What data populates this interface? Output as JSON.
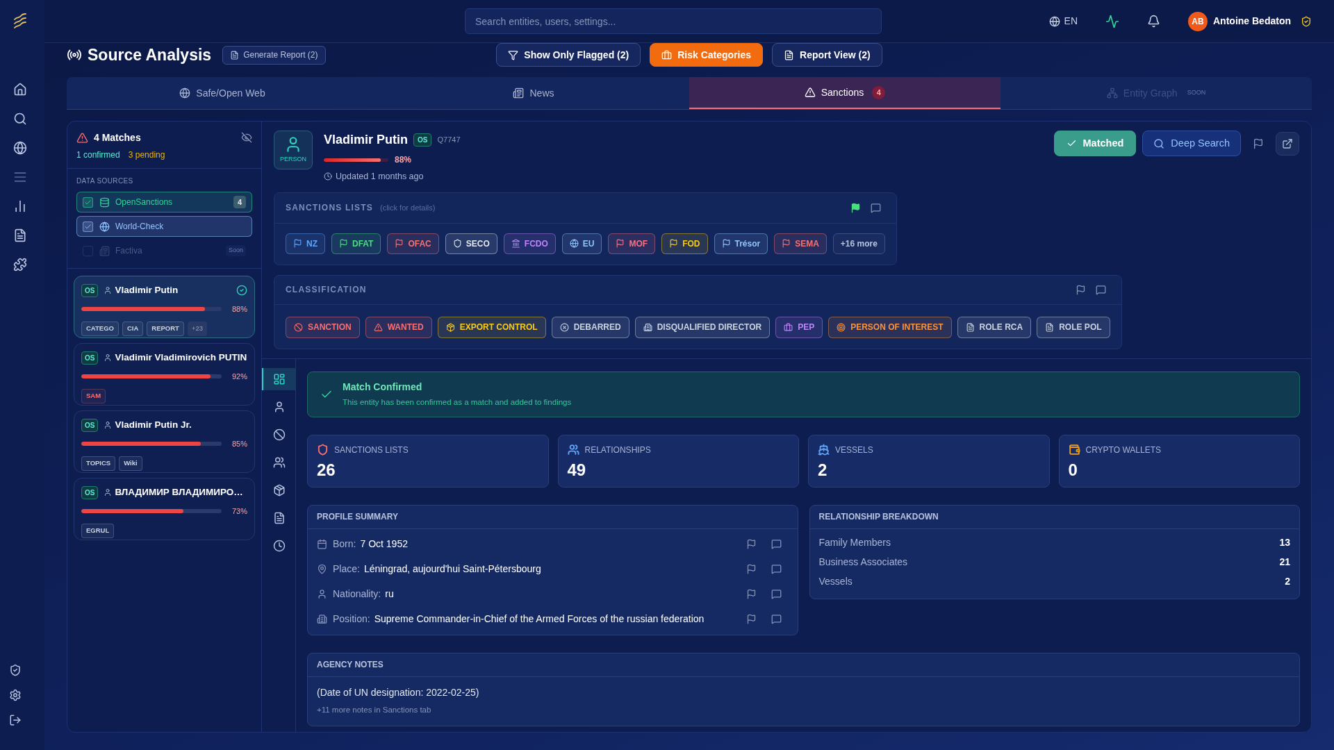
{
  "top_bar": {
    "search": {
      "placeholder": "Search entities, users, settings..."
    },
    "language": "EN",
    "user": {
      "initials": "AB",
      "name": "Antoine Bedaton"
    }
  },
  "sidebar": {
    "items": [
      {
        "disabled": false
      },
      {
        "disabled": false
      },
      {
        "disabled": false
      },
      {
        "disabled": true
      },
      {
        "disabled": false
      },
      {
        "disabled": false
      },
      {
        "disabled": false
      }
    ]
  },
  "page": {
    "title": "Source Analysis",
    "generate_report": "Generate Report (2)",
    "actions": [
      {
        "label": "Show Only Flagged (2)",
        "selected": false
      },
      {
        "label": "Risk Categories",
        "selected": true
      },
      {
        "label": "Report View (2)",
        "selected": false
      }
    ]
  },
  "tabs": [
    {
      "label": "Safe/Open Web",
      "selected": false,
      "disabled": false
    },
    {
      "label": "News",
      "selected": false,
      "disabled": false
    },
    {
      "label": "Sanctions",
      "selected": true,
      "disabled": false,
      "count": "4"
    },
    {
      "label": "Entity Graph",
      "selected": false,
      "disabled": true,
      "note": "SOON"
    }
  ],
  "matches_panel": {
    "title": "4 Matches",
    "confirmed": "1 confirmed",
    "pending": "3 pending",
    "data_sources": {
      "label": "DATA SOURCES",
      "items": [
        {
          "name": "OpenSanctions",
          "kind": "database",
          "checked": true,
          "disabled": false,
          "color": "#34d399",
          "count": "4"
        },
        {
          "name": "World-Check",
          "kind": "globe",
          "checked": true,
          "disabled": false,
          "color": "#93c5fd"
        },
        {
          "name": "Factiva",
          "kind": "news",
          "checked": false,
          "disabled": true,
          "color": "#4b5b87",
          "note": "Soon"
        }
      ]
    },
    "matches": [
      {
        "source": "OS",
        "name": "Vladimir Putin",
        "confirmed": true,
        "selected": true,
        "level": 0.88,
        "score": "88%",
        "tags": [
          {
            "label": "CATEGO",
            "color": "#cbd5e1"
          },
          {
            "label": "CIA",
            "color": "#cbd5e1"
          },
          {
            "label": "REPORT",
            "color": "#cbd5e1"
          }
        ],
        "more": "+23"
      },
      {
        "source": "OS",
        "name": "Vladimir Vladimirovich PUTIN",
        "confirmed": false,
        "selected": false,
        "level": 0.92,
        "score": "92%",
        "tags": [
          {
            "label": "SAM",
            "color": "#f87171"
          }
        ]
      },
      {
        "source": "OS",
        "name": "Vladimir Putin Jr.",
        "confirmed": false,
        "selected": false,
        "level": 0.85,
        "score": "85%",
        "tags": [
          {
            "label": "TOPICS",
            "color": "#cbd5e1"
          },
          {
            "label": "Wiki",
            "color": "#cbd5e1"
          }
        ]
      },
      {
        "source": "OS",
        "name": "ВЛАДИМИР ВЛАДИМИРО…",
        "confirmed": false,
        "selected": false,
        "level": 0.73,
        "score": "73%",
        "tags": [
          {
            "label": "EGRUL",
            "color": "#cbd5e1"
          }
        ]
      }
    ]
  },
  "entity": {
    "type": "PERSON",
    "name": "Vladimir Putin",
    "source": "OS",
    "id": "Q7747",
    "level": 0.88,
    "score": "88%",
    "updated": "Updated 1 months ago",
    "matched": true,
    "matched_label": "Matched",
    "deep_search": "Deep Search"
  },
  "sanctions_lists": {
    "title": "SANCTIONS LISTS",
    "hint": "(click for details)",
    "flagged": true,
    "items": [
      {
        "label": "NZ",
        "kind": "flag",
        "color": "#60a5fa"
      },
      {
        "label": "DFAT",
        "kind": "flag",
        "color": "#4ade80"
      },
      {
        "label": "OFAC",
        "kind": "flag",
        "color": "#f87171"
      },
      {
        "label": "SECO",
        "kind": "shield",
        "color": "#e2e8f0"
      },
      {
        "label": "FCDO",
        "kind": "bank",
        "color": "#c084fc"
      },
      {
        "label": "EU",
        "kind": "globe",
        "color": "#93c5fd"
      },
      {
        "label": "MOF",
        "kind": "flag",
        "color": "#fb7185"
      },
      {
        "label": "FOD",
        "kind": "flag",
        "color": "#facc15"
      },
      {
        "label": "Trésor",
        "kind": "flag",
        "color": "#93c5fd"
      },
      {
        "label": "SEMA",
        "kind": "flag",
        "color": "#f87171"
      }
    ],
    "more": "+16 more"
  },
  "classification": {
    "title": "CLASSIFICATION",
    "flagged": false,
    "items": [
      {
        "label": "SANCTION",
        "kind": "ban",
        "color": "#f87171"
      },
      {
        "label": "WANTED",
        "kind": "alert",
        "color": "#f87171"
      },
      {
        "label": "EXPORT CONTROL",
        "kind": "box",
        "color": "#facc15"
      },
      {
        "label": "DEBARRED",
        "kind": "x",
        "color": "#cbd5e1"
      },
      {
        "label": "DISQUALIFIED DIRECTOR",
        "kind": "building",
        "color": "#cbd5e1"
      },
      {
        "label": "PEP",
        "kind": "briefcase",
        "color": "#c084fc"
      },
      {
        "label": "PERSON OF INTEREST",
        "kind": "target",
        "color": "#fb923c"
      },
      {
        "label": "ROLE RCA",
        "kind": "file",
        "color": "#cbd5e1"
      },
      {
        "label": "ROLE POL",
        "kind": "file",
        "color": "#cbd5e1"
      }
    ]
  },
  "detail_nav": [
    {
      "selected": true
    },
    {
      "selected": false
    },
    {
      "selected": false
    },
    {
      "selected": false
    },
    {
      "selected": false
    },
    {
      "selected": false
    },
    {
      "selected": false
    }
  ],
  "match_banner": {
    "title": "Match Confirmed",
    "text": "This entity has been confirmed as a match and added to findings"
  },
  "stats": [
    {
      "label": "SANCTIONS LISTS",
      "value": "26",
      "kind": "shield",
      "color": "#f87171"
    },
    {
      "label": "RELATIONSHIPS",
      "value": "49",
      "kind": "users",
      "color": "#60a5fa"
    },
    {
      "label": "VESSELS",
      "value": "2",
      "kind": "ship",
      "color": "#60a5fa"
    },
    {
      "label": "CRYPTO WALLETS",
      "value": "0",
      "kind": "wallet",
      "color": "#f59e0b"
    }
  ],
  "profile_summary": {
    "title": "PROFILE SUMMARY",
    "rows": [
      {
        "kind": "date",
        "label": "Born:",
        "value": "7 Oct 1952"
      },
      {
        "kind": "place",
        "label": "Place:",
        "value": "Léningrad, aujourd'hui Saint-Pétersbourg"
      },
      {
        "kind": "person",
        "label": "Nationality:",
        "value": "ru"
      },
      {
        "kind": "building",
        "label": "Position:",
        "value": "Supreme Commander-in-Chief of the Armed Forces of the russian federation"
      }
    ]
  },
  "relationship_breakdown": {
    "title": "RELATIONSHIP BREAKDOWN",
    "rows": [
      {
        "label": "Family Members",
        "value": "13"
      },
      {
        "label": "Business Associates",
        "value": "21"
      },
      {
        "label": "Vessels",
        "value": "2"
      }
    ]
  },
  "agency_notes": {
    "title": "AGENCY NOTES",
    "notes": [
      "(Date of UN designation: 2022-02-25)"
    ],
    "more": "+11 more notes in Sanctions tab"
  }
}
